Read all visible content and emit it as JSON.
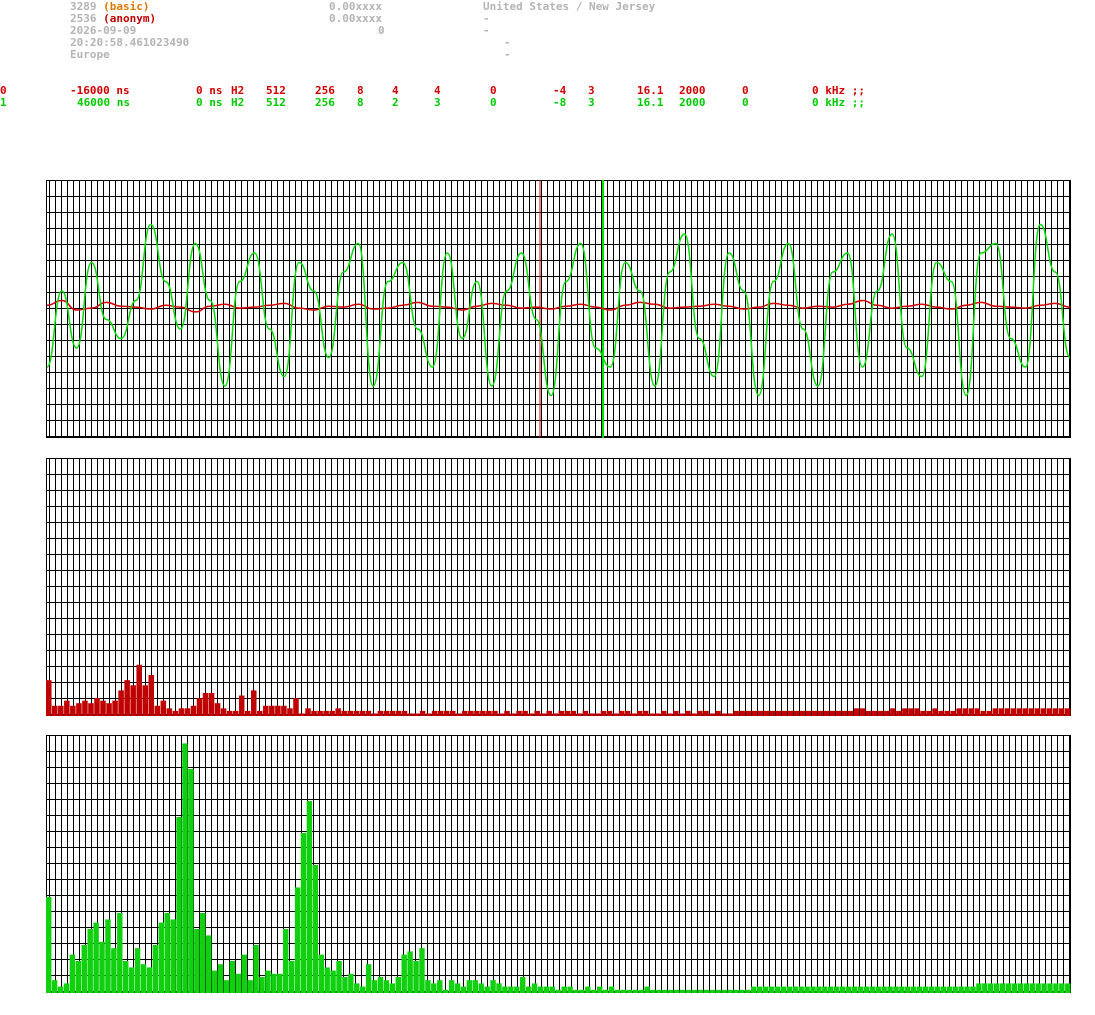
{
  "header": {
    "left": [
      {
        "text": "3289",
        "tag": "(basic)",
        "tag_color": "#e07800"
      },
      {
        "text": "2536",
        "tag": "(anonym)",
        "tag_color": "#c00000"
      },
      {
        "text": "2026-09-09"
      },
      {
        "text": "20:20:58.461023490"
      },
      {
        "text": "Europe"
      }
    ],
    "mid": [
      "0.00xxxx",
      "0.00xxxx",
      "0"
    ],
    "right": [
      "United States / New Jersey",
      "-",
      "-",
      "-",
      "-"
    ]
  },
  "channels": [
    {
      "id": "0",
      "offset": "-16000 ns",
      "c2": "0 ns",
      "c3": "H2",
      "c4": "512",
      "c5": "256",
      "c6": "8",
      "c7": "4",
      "c8": "4",
      "c9": "0",
      "c10": "-4",
      "c11": "3",
      "c12": "16.1",
      "c13": "2000",
      "c14": "0",
      "c15": "0 kHz ;;",
      "color": "#d40000"
    },
    {
      "id": "1",
      "offset": "46000 ns",
      "c2": "0 ns",
      "c3": "H2",
      "c4": "512",
      "c5": "256",
      "c6": "8",
      "c7": "2",
      "c8": "3",
      "c9": "0",
      "c10": "-8",
      "c11": "3",
      "c12": "16.1",
      "c13": "2000",
      "c14": "0",
      "c15": "0 kHz ;;",
      "color": "#00cc00"
    }
  ],
  "colors": {
    "grid": "#000000",
    "red_series": "#d40000",
    "green_series": "#00dd00",
    "red_bar": "#c00000",
    "green_bar": "#10d010"
  },
  "chart_data": [
    {
      "type": "line",
      "series": [
        {
          "values": [
            0.05,
            0.1,
            0.0,
            0.02,
            0.08,
            0.04,
            0.03,
            0.01,
            0.05,
            0.03,
            -0.02,
            0.04,
            0.06,
            0.02,
            0.03,
            0.05,
            0.07,
            0.02,
            0.0,
            0.04,
            0.03,
            0.06,
            0.01,
            0.02,
            0.05,
            0.08,
            0.04,
            0.03,
            0.0,
            0.04,
            0.07,
            0.05,
            0.02,
            0.03,
            0.01,
            0.04,
            0.06,
            0.03,
            0.0,
            0.05,
            0.08,
            0.06,
            0.02,
            0.03,
            0.04,
            0.06,
            0.04,
            0.01,
            0.03,
            0.07,
            0.05,
            0.02,
            0.04,
            0.03,
            0.06,
            0.1,
            0.05,
            0.02,
            0.04,
            0.06,
            0.03,
            0.01,
            0.05,
            0.08,
            0.04,
            0.03,
            0.02,
            0.05,
            0.07,
            0.03
          ]
        },
        {
          "values": [
            -0.6,
            0.2,
            -0.4,
            0.5,
            -0.1,
            -0.3,
            0.1,
            0.9,
            0.3,
            -0.2,
            0.7,
            0.1,
            -0.8,
            0.3,
            0.6,
            -0.2,
            -0.7,
            0.5,
            0.2,
            -0.5,
            0.4,
            0.7,
            -0.8,
            0.3,
            0.5,
            -0.2,
            -0.6,
            0.6,
            -0.3,
            0.3,
            -0.8,
            0.2,
            0.6,
            -0.1,
            -0.9,
            0.3,
            0.7,
            -0.4,
            -0.6,
            0.5,
            0.2,
            -0.8,
            0.4,
            0.8,
            -0.3,
            -0.7,
            0.6,
            0.2,
            -0.9,
            0.3,
            0.7,
            -0.2,
            -0.8,
            0.4,
            0.6,
            -0.6,
            0.2,
            0.8,
            -0.4,
            -0.7,
            0.5,
            0.3,
            -0.9,
            0.6,
            0.7,
            -0.3,
            -0.6,
            0.9,
            0.4,
            -0.5
          ]
        }
      ]
    },
    {
      "type": "bar",
      "values": [
        14,
        4,
        4,
        6,
        4,
        5,
        6,
        5,
        7,
        6,
        5,
        6,
        10,
        14,
        12,
        20,
        12,
        16,
        4,
        6,
        3,
        2,
        3,
        3,
        4,
        7,
        9,
        9,
        5,
        3,
        2,
        2,
        8,
        2,
        10,
        2,
        4,
        4,
        4,
        4,
        3,
        7,
        1,
        3,
        2,
        2,
        2,
        2,
        3,
        2,
        2,
        2,
        2,
        2,
        1,
        2,
        2,
        2,
        2,
        2,
        1,
        1,
        2,
        1,
        2,
        2,
        2,
        2,
        1,
        2,
        2,
        2,
        2,
        2,
        2,
        1,
        2,
        1,
        2,
        2,
        1,
        2,
        1,
        2,
        1,
        2,
        2,
        2,
        1,
        2,
        1,
        1,
        2,
        2,
        1,
        2,
        2,
        1,
        2,
        2,
        1,
        1,
        2,
        1,
        2,
        1,
        2,
        1,
        2,
        2,
        1,
        2,
        1,
        1,
        2,
        2,
        2,
        2,
        2,
        2,
        2,
        2,
        2,
        2,
        2,
        2,
        2,
        2,
        2,
        2,
        2,
        2,
        2,
        2,
        3,
        3,
        2,
        2,
        2,
        2,
        3,
        2,
        3,
        3,
        3,
        2,
        2,
        3,
        2,
        2,
        2,
        3,
        3,
        3,
        3,
        2,
        2,
        3,
        3,
        3,
        3,
        3,
        3,
        3,
        3,
        3,
        3,
        3,
        3,
        3
      ],
      "ylim": [
        0,
        100
      ]
    },
    {
      "type": "bar",
      "values": [
        30,
        4,
        2,
        3,
        12,
        10,
        15,
        20,
        22,
        16,
        23,
        14,
        25,
        10,
        8,
        14,
        9,
        8,
        15,
        22,
        25,
        23,
        55,
        78,
        70,
        20,
        25,
        18,
        7,
        9,
        4,
        10,
        6,
        12,
        4,
        15,
        5,
        7,
        6,
        6,
        20,
        10,
        33,
        50,
        60,
        40,
        12,
        8,
        7,
        10,
        5,
        6,
        3,
        2,
        9,
        4,
        5,
        4,
        3,
        5,
        12,
        13,
        10,
        14,
        4,
        3,
        4,
        1,
        4,
        3,
        2,
        4,
        4,
        3,
        2,
        4,
        3,
        2,
        2,
        2,
        5,
        2,
        3,
        2,
        2,
        2,
        1,
        2,
        2,
        1,
        1,
        2,
        1,
        2,
        1,
        2,
        1,
        1,
        1,
        1,
        1,
        2,
        1,
        1,
        1,
        1,
        1,
        1,
        1,
        1,
        1,
        1,
        1,
        1,
        1,
        1,
        1,
        1,
        1,
        2,
        2,
        2,
        2,
        2,
        2,
        2,
        2,
        2,
        2,
        2,
        2,
        2,
        2,
        2,
        2,
        2,
        2,
        2,
        2,
        2,
        2,
        2,
        2,
        2,
        2,
        2,
        2,
        2,
        2,
        2,
        2,
        2,
        2,
        2,
        2,
        2,
        2,
        3,
        3,
        3,
        3,
        3,
        3,
        3,
        3,
        3,
        3,
        3,
        3,
        3,
        3,
        3,
        3
      ],
      "ylim": [
        0,
        80
      ]
    }
  ]
}
